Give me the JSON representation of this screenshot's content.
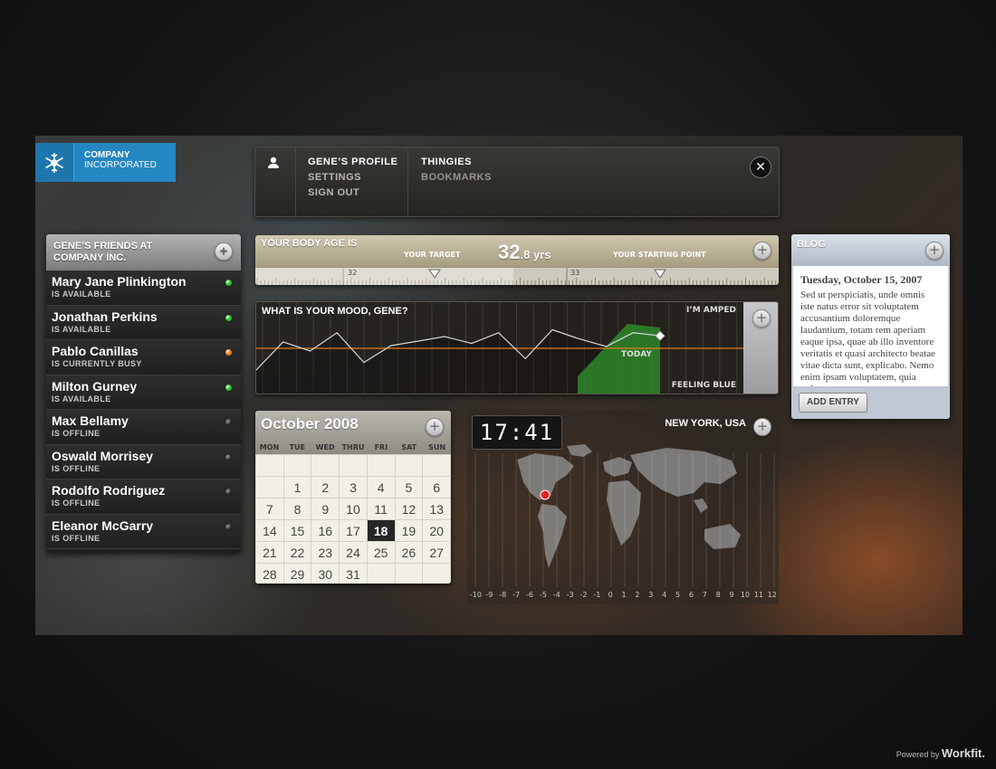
{
  "logo": {
    "line1": "COMPANY",
    "line2": "INCORPORATED"
  },
  "profile": {
    "title": "GENE’S PROFILE",
    "settings": "SETTINGS",
    "sign_out": "SIGN OUT",
    "thingies": "THINGIES",
    "bookmarks": "BOOKMARKS",
    "close": "✕"
  },
  "friends": {
    "title_line1": "GENE’S FRIENDS AT",
    "title_line2": "COMPANY INC.",
    "add": "+",
    "items": [
      {
        "name": "Mary Jane Plinkington",
        "status": "IS AVAILABLE",
        "state": "available"
      },
      {
        "name": "Jonathan Perkins",
        "status": "IS AVAILABLE",
        "state": "available"
      },
      {
        "name": "Pablo Canillas",
        "status": "IS CURRENTLY BUSY",
        "state": "busy"
      },
      {
        "name": "Milton Gurney",
        "status": "IS AVAILABLE",
        "state": "available"
      },
      {
        "name": "Max Bellamy",
        "status": "IS OFFLINE",
        "state": "offline"
      },
      {
        "name": "Oswald Morrisey",
        "status": "IS OFFLINE",
        "state": "offline"
      },
      {
        "name": "Rodolfo Rodriguez",
        "status": "IS OFFLINE",
        "state": "offline"
      },
      {
        "name": "Eleanor McGarry",
        "status": "IS OFFLINE",
        "state": "offline"
      }
    ]
  },
  "status_colors": {
    "available": "#22c51f",
    "busy": "#f07b1e",
    "offline": "#3a3a3a"
  },
  "body_age": {
    "title": "YOUR BODY AGE IS",
    "value_main": "32",
    "value_dec": ".8 yrs",
    "target_label": "YOUR TARGET",
    "start_label": "YOUR STARTING POINT",
    "tick_32": "32",
    "tick_33": "33",
    "add": "+"
  },
  "mood": {
    "title": "WHAT IS YOUR MOOD, GENE?",
    "top_label": "I’M AMPED",
    "bottom_label": "FEELING BLUE",
    "today_label": "TODAY",
    "add": "+",
    "values": [
      0.25,
      0.62,
      0.5,
      0.74,
      0.35,
      0.57,
      0.63,
      0.69,
      0.6,
      0.74,
      0.4,
      0.78,
      0.66,
      0.56,
      0.74,
      0.7
    ]
  },
  "calendar": {
    "title": "October 2008",
    "add": "+",
    "weekdays": [
      "MON",
      "TUE",
      "WED",
      "THRU",
      "FRI",
      "SAT",
      "SUN"
    ],
    "weeks": [
      [
        "",
        "",
        "",
        "",
        "",
        "",
        ""
      ],
      [
        "",
        "1",
        "2",
        "3",
        "4",
        "5",
        "6"
      ],
      [
        "7",
        "8",
        "9",
        "10",
        "11",
        "12",
        "13"
      ],
      [
        "14",
        "15",
        "16",
        "17",
        "18",
        "19",
        "20"
      ],
      [
        "21",
        "22",
        "23",
        "24",
        "25",
        "26",
        "27"
      ],
      [
        "28",
        "29",
        "30",
        "31",
        "",
        "",
        ""
      ]
    ],
    "today": "18"
  },
  "world_clock": {
    "time": "17:41",
    "city": "NEW YORK, USA",
    "add": "+",
    "timezones": [
      "-10",
      "-9",
      "-8",
      "-7",
      "-6",
      "-5",
      "-4",
      "-3",
      "-2",
      "-1",
      "0",
      "1",
      "2",
      "3",
      "4",
      "5",
      "6",
      "7",
      "8",
      "9",
      "10",
      "11",
      "12"
    ]
  },
  "blog": {
    "title": "BLOG",
    "add": "+",
    "date": "Tuesday, October 15, 2007",
    "text": "Sed ut perspiciatis, unde omnis iste natus error sit voluptatem accusantium doloremque laudantium, totam rem aperiam eaque ipsa, quae ab illo inventore veritatis et quasi architecto beatae vitae dicta sunt, explicabo. Nemo enim ipsam voluptatem, quia volup",
    "add_entry": "ADD ENTRY"
  },
  "footer": {
    "powered_by": "Powered by",
    "brand": "Workfit."
  }
}
